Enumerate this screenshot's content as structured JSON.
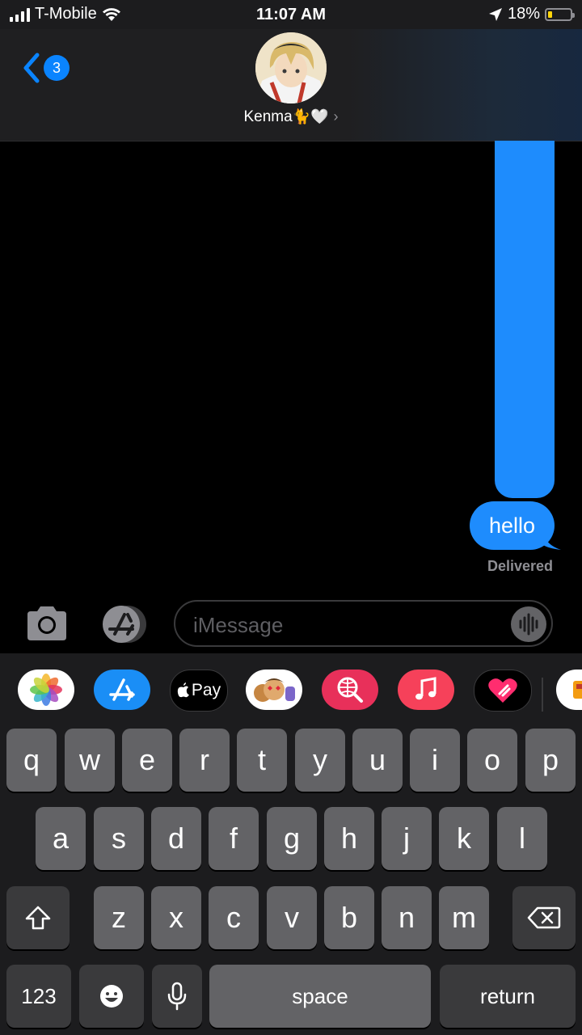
{
  "status_bar": {
    "carrier": "T-Mobile",
    "time": "11:07 AM",
    "battery_percent": "18%",
    "battery_level": 0.18,
    "icons": [
      "signal-icon",
      "wifi-icon",
      "location-icon",
      "battery-icon"
    ]
  },
  "header": {
    "back_badge": "3",
    "contact_name": "Kenma",
    "contact_emoji": "🐈🤍",
    "chevron": "›"
  },
  "messages": [
    {
      "text": "hello",
      "sender": "me"
    }
  ],
  "message_status": "Delivered",
  "input": {
    "placeholder": "iMessage",
    "value": ""
  },
  "app_strip": {
    "items": [
      "photos-app",
      "app-store",
      "apple-pay",
      "memoji-stickers",
      "images-search",
      "music",
      "digital-touch",
      "more-app"
    ],
    "apple_pay_label": "Pay"
  },
  "keyboard": {
    "row1": [
      "q",
      "w",
      "e",
      "r",
      "t",
      "y",
      "u",
      "i",
      "o",
      "p"
    ],
    "row2": [
      "a",
      "s",
      "d",
      "f",
      "g",
      "h",
      "j",
      "k",
      "l"
    ],
    "row3": [
      "z",
      "x",
      "c",
      "v",
      "b",
      "n",
      "m"
    ],
    "numbers_label": "123",
    "space_label": "space",
    "return_label": "return"
  },
  "colors": {
    "bubble_blue": "#1e8cfd",
    "accent": "#0a84ff",
    "key": "#636366",
    "key_func": "#3a3a3c"
  }
}
